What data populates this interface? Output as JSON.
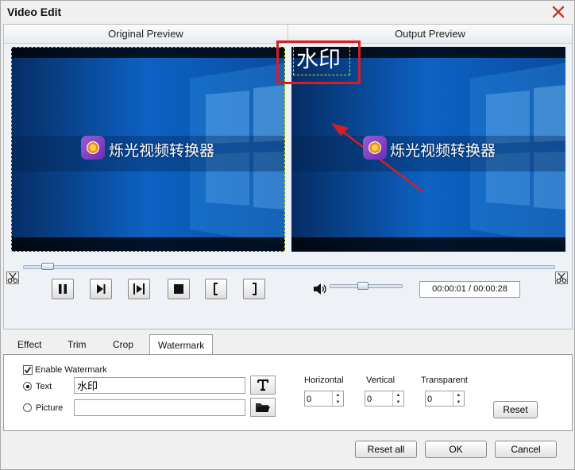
{
  "window": {
    "title": "Video Edit"
  },
  "preview": {
    "original_label": "Original Preview",
    "output_label": "Output Preview",
    "logo_text": "烁光视频转换器",
    "watermark_text": "水印"
  },
  "playback": {
    "time_display": "00:00:01 / 00:00:28",
    "position_fraction": 0.03,
    "volume_fraction": 0.45
  },
  "tabs": [
    {
      "label": "Effect"
    },
    {
      "label": "Trim"
    },
    {
      "label": "Crop"
    },
    {
      "label": "Watermark",
      "active": true
    }
  ],
  "watermark_panel": {
    "enable_label": "Enable Watermark",
    "enable_checked": true,
    "text_label": "Text",
    "picture_label": "Picture",
    "text_value": "水印",
    "picture_value": "",
    "horizontal_label": "Horizontal",
    "horizontal_value": "0",
    "vertical_label": "Vertical",
    "vertical_value": "0",
    "transparent_label": "Transparent",
    "transparent_value": "0",
    "reset_label": "Reset"
  },
  "footer": {
    "reset_all_label": "Reset all",
    "ok_label": "OK",
    "cancel_label": "Cancel"
  },
  "colors": {
    "accent_red": "#d81e24",
    "selection_dash": "#d7e000",
    "video_blue": "#0b5fc0"
  }
}
